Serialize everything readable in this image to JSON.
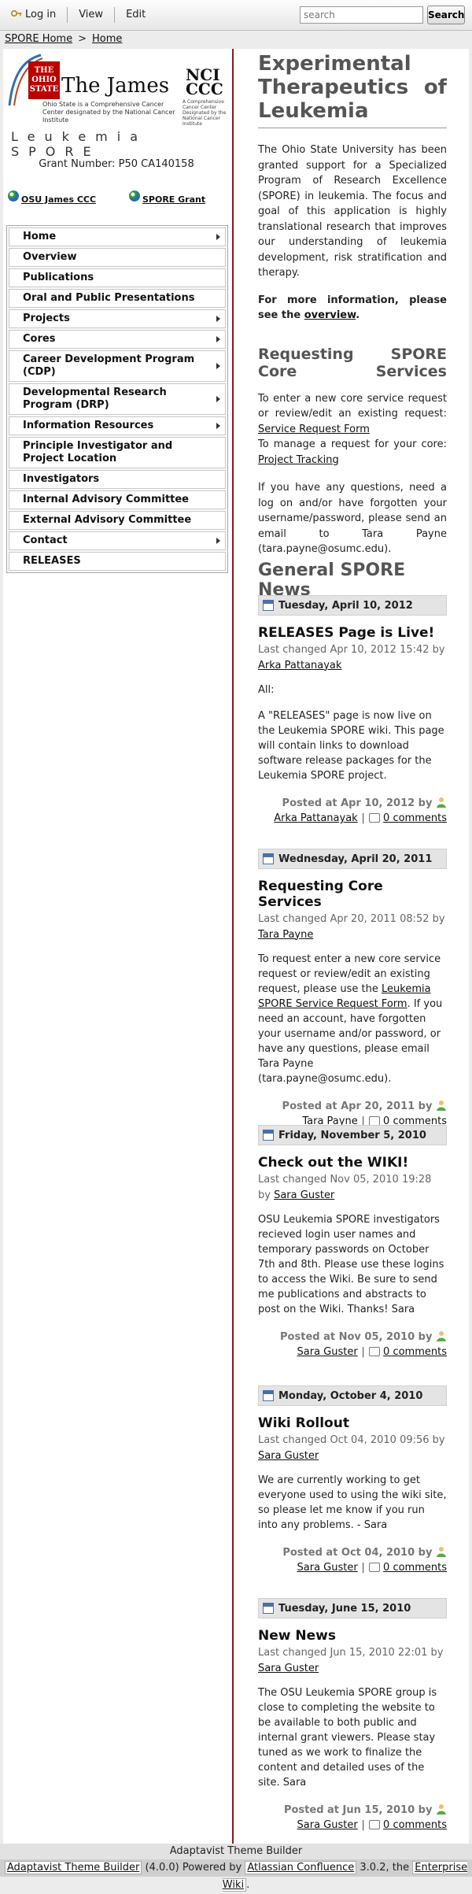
{
  "topnav": {
    "login": "Log in",
    "view": "View",
    "edit": "Edit"
  },
  "search": {
    "placeholder": "search",
    "button": "Search"
  },
  "breadcrumb": {
    "home": "SPORE Home",
    "sep": ">",
    "page": "Home"
  },
  "logos": {
    "osu_top": "THE",
    "osu_mid": "OHIO",
    "osu_bot": "STATE",
    "james": "The James",
    "osu_sub": "Ohio State is a Comprehensive Cancer Center designated by the National Cancer Institute",
    "nci_line1": "NCI",
    "nci_line2": "CCC",
    "nci_sub": "A Comprehensive Cancer Center Designated by the National Cancer Institute"
  },
  "sidebar": {
    "spore_title": "Leukemia SPORE",
    "grant": "Grant Number: P50 CA140158",
    "quick_links": [
      "OSU James CCC",
      "SPORE Grant"
    ],
    "nav": [
      {
        "label": "Home",
        "arrow": true
      },
      {
        "label": "Overview",
        "arrow": false
      },
      {
        "label": "Publications",
        "arrow": false
      },
      {
        "label": "Oral and Public Presentations",
        "arrow": false
      },
      {
        "label": "Projects",
        "arrow": true
      },
      {
        "label": "Cores",
        "arrow": true
      },
      {
        "label": "Career Development Program (CDP)",
        "arrow": true
      },
      {
        "label": "Developmental Research Program (DRP)",
        "arrow": true
      },
      {
        "label": "Information Resources",
        "arrow": true
      },
      {
        "label": "Principle Investigator and Project Location",
        "arrow": false
      },
      {
        "label": "Investigators",
        "arrow": false
      },
      {
        "label": "Internal Advisory Committee",
        "arrow": false
      },
      {
        "label": "External Advisory Committee",
        "arrow": false
      },
      {
        "label": "Contact",
        "arrow": true
      },
      {
        "label": "RELEASES",
        "arrow": false
      }
    ]
  },
  "main": {
    "title": "Experimental Therapeutics of Leukemia",
    "intro": "The Ohio State University has been granted support for a Specialized Program of Research Excellence (SPORE) in leukemia. The focus and goal of this application is highly translational research that improves our understanding of leukemia development, risk stratification and therapy.",
    "more_info_prefix": "For more information, please see the",
    "more_info_link": "overview",
    "more_info_suffix": ".",
    "req_title": "Requesting SPORE Core Services",
    "req_text1_prefix": "To enter a new core service request or review/edit an existing request:",
    "req_link1": "Service Request Form",
    "req_text2_prefix": "To manage a request for your core:",
    "req_link2": "Project Tracking",
    "questions": "If you have any questions, need a log on and/or have forgotten your username/password, please send an email to Tara Payne (tara.payne@osumc.edu).",
    "news_title": "General SPORE News"
  },
  "news": [
    {
      "date": "Tuesday, April 10, 2012",
      "title": "RELEASES Page is Live!",
      "meta": "Last changed Apr 10, 2012 15:42 by",
      "author": "Arka Pattanayak",
      "body": [
        "All:",
        "A \"RELEASES\" page is now live on the Leukemia SPORE wiki. This page will contain links to download software release packages for the Leukemia SPORE project."
      ],
      "posted": "Posted at Apr 10, 2012 by",
      "comments": "0 comments"
    },
    {
      "date": "Wednesday, April 20, 2011",
      "title": "Requesting Core Services",
      "meta": "Last changed Apr 20, 2011 08:52 by",
      "author": "Tara Payne",
      "body_prefix": "To request enter a new core service request or review/edit an existing request, please use the",
      "body_link": "Leukemia SPORE Service Request Form",
      "body_suffix": ". If you need an account, have forgotten your username and/or password, or have any questions, please email Tara Payne (tara.payne@osumc.edu).",
      "posted": "Posted at Apr 20, 2011 by",
      "comments": "0 comments"
    },
    {
      "date": "Friday, November 5, 2010",
      "title": "Check out the WIKI!",
      "meta": "Last changed Nov 05, 2010 19:28 by",
      "author": "Sara Guster",
      "body": [
        "OSU Leukemia SPORE investigators recieved login user names and temporary passwords on October 7th and 8th. Please use these logins to access the Wiki. Be sure to send me publications and abstracts to post on the Wiki. Thanks! Sara"
      ],
      "posted": "Posted at Nov 05, 2010 by",
      "comments": "0 comments"
    },
    {
      "date": "Monday, October 4, 2010",
      "title": "Wiki Rollout",
      "meta": "Last changed Oct 04, 2010 09:56 by",
      "author": "Sara Guster",
      "body": [
        "We are currently working to get everyone used to using the wiki site, so please let me know if you run into any problems. - Sara"
      ],
      "posted": "Posted at Oct 04, 2010 by",
      "comments": "0 comments"
    },
    {
      "date": "Tuesday, June 15, 2010",
      "title": "New News",
      "meta": "Last changed Jun 15, 2010 22:01 by",
      "author": "Sara Guster",
      "body": [
        "The OSU Leukemia SPORE group is close to completing the website to be available to both public and internal grant viewers. Please stay tuned as we work to finalize the content and detailed uses of the site. Sara"
      ],
      "posted": "Posted at Jun 15, 2010 by",
      "comments": "0 comments"
    }
  ],
  "footer": {
    "line1": "Adaptavist Theme Builder",
    "link1": "Adaptavist Theme Builder",
    "version": "(4.0.0) Powered by",
    "link2": "Atlassian Confluence",
    "conf_version": "3.0.2, the",
    "link3": "Enterprise Wiki",
    "end": "."
  }
}
